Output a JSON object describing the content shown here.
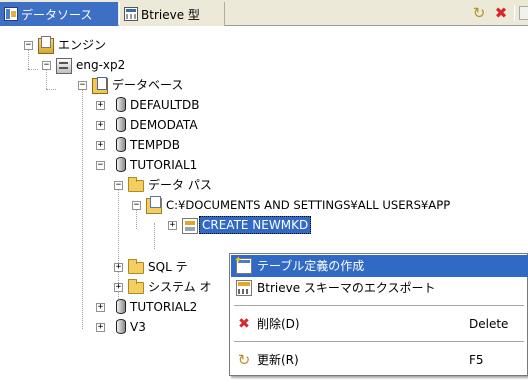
{
  "tabs": {
    "datasource_label": "データソース",
    "btrieve_label": "Btrieve 型"
  },
  "toolbar": {
    "refresh_icon": "refresh-icon",
    "delete_icon": "delete-icon"
  },
  "tree": {
    "engines": "エンジン",
    "server": "eng-xp2",
    "databases": "データベース",
    "db_defaulttdb": "DEFAULTDB",
    "db_demodata": "DEMODATA",
    "db_tempdb": "TEMPDB",
    "db_tutorial1": "TUTORIAL1",
    "data_path": "データ パス",
    "path_value": "C:¥DOCUMENTS AND SETTINGS¥ALL USERS¥APP",
    "dict_item": "CREATE NEWMKD",
    "sql_folder": "SQL テ",
    "system_folder": "システム オ",
    "db_tutorial2": "TUTORIAL2",
    "db_v3": "V3"
  },
  "context_menu": {
    "create_table": "テーブル定義の作成",
    "export_schema": "Btrieve スキーマのエクスポート",
    "delete_label": "削除(D)",
    "delete_shortcut": "Delete",
    "refresh_label": "更新(R)",
    "refresh_shortcut": "F5"
  },
  "colors": {
    "selection": "#316ac5",
    "tab_active": "#3d6fc4",
    "tabbar_bg": "#ece9d8",
    "delete_red": "#d8262b"
  }
}
